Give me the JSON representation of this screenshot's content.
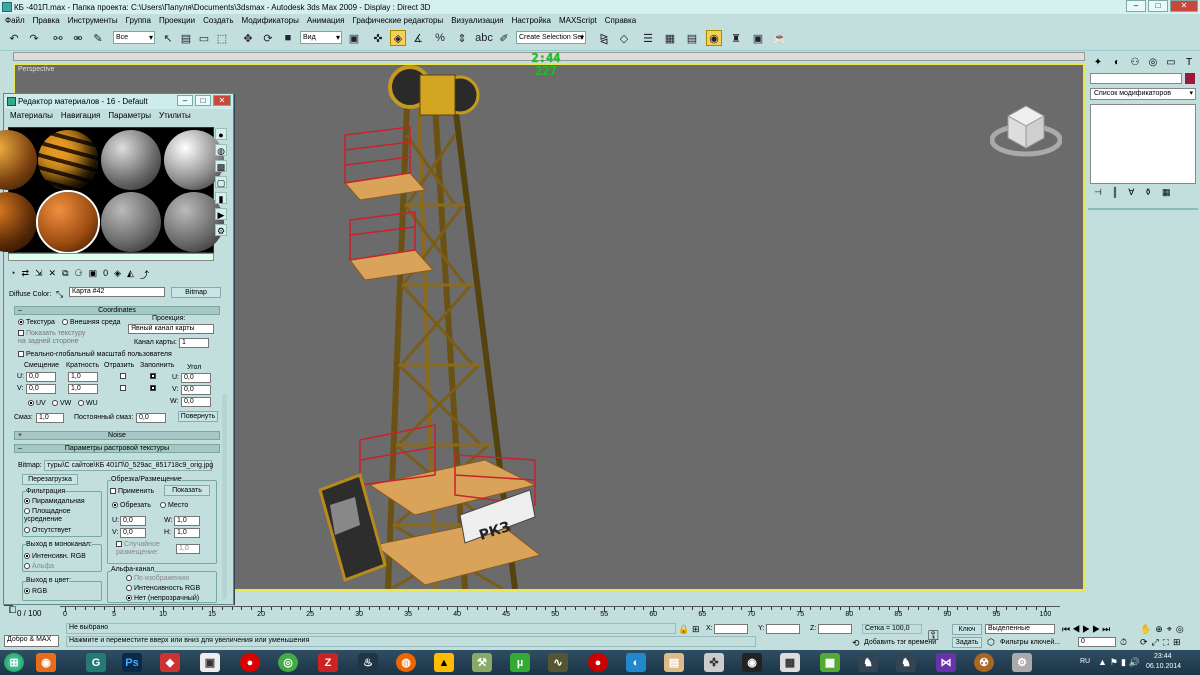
{
  "window": {
    "title": "КБ -401П.max      - Папка проекта: C:\\Users\\Папуля\\Documents\\3dsmax      - Autodesk 3ds Max  2009          - Display : Direct 3D"
  },
  "menu": [
    "Файл",
    "Правка",
    "Инструменты",
    "Группа",
    "Проекции",
    "Создать",
    "Модификаторы",
    "Анимация",
    "Графические редакторы",
    "Визуализация",
    "Настройка",
    "MAXScript",
    "Справка"
  ],
  "toolbar": {
    "filter": "Все",
    "refcoord": "Вид",
    "selection_set": "Create Selection Set"
  },
  "viewport": {
    "label": "Perspective",
    "fps_top": "2:44",
    "fps": "227"
  },
  "right_panel": {
    "modifier_list": "Список модификаторов",
    "object_color": "#9b1a3a"
  },
  "material_editor": {
    "title": "Редактор материалов - 16 - Default",
    "menu": [
      "Материалы",
      "Навигация",
      "Параметры",
      "Утилиты"
    ],
    "diffuse_label": "Diffuse Color:",
    "map_name": "Карта #42",
    "map_type": "Bitmap",
    "coordinates": {
      "header": "Coordinates",
      "texture": "Текстура",
      "environ": "Внешняя среда",
      "mapping_label": "Проекция:",
      "mapping": "Явный канал карты",
      "show_back": "Показать текстуру на задней стороне",
      "map_channel_label": "Канал карты:",
      "map_channel": "1",
      "real_world": "Реально-глобальный масштаб пользователя",
      "offset_label": "Смещение",
      "tiling_label": "Кратность",
      "mirror_label": "Отразить",
      "tile_label": "Заполнить",
      "angle_label": "Угол",
      "u_off": "0,0",
      "v_off": "0,0",
      "u_tile": "1,0",
      "v_tile": "1,0",
      "u_ang": "0,0",
      "v_ang": "0,0",
      "w_ang": "0,0",
      "uv": "UV",
      "vw": "VW",
      "wu": "WU",
      "blur_label": "Смаз:",
      "blur": "1,0",
      "blur_off_label": "Постоянный смаз:",
      "blur_off": "0,0",
      "rotate_btn": "Повернуть"
    },
    "noise_header": "Noise",
    "bitmap_params_header": "Параметры растровой текстуры",
    "bitmap_label": "Bitmap:",
    "bitmap_path": "туры\\С сайтов\\КБ 401П\\0_529ac_851718c9_orig.jpg",
    "reload_btn": "Перезагрузка",
    "filtering": {
      "label": "Фильтрация",
      "pyramidal": "Пирамидальная",
      "summed": "Площадное усреднение",
      "none": "Отсутствует"
    },
    "mono": {
      "label": "Выход в моноканал:",
      "rgb": "Интенсивн. RGB",
      "alpha": "Альфа"
    },
    "rgb_out": {
      "label": "Выход в цвет:",
      "rgb": "RGB"
    },
    "crop": {
      "label": "Обрезка/Размещение",
      "apply": "Применить",
      "view": "Показать",
      "crop": "Обрезать",
      "place": "Место",
      "u": "0,0",
      "v": "0,0",
      "w": "1,0",
      "h": "1,0",
      "jitter": "Случайное размещение:",
      "jitter_val": "1,0"
    },
    "alpha_src": {
      "label": "Альфа-канал",
      "image": "По изображению",
      "rgb": "Интенсивность RGB",
      "none": "Нет (непрозрачный)"
    }
  },
  "timeline": {
    "ticks": [
      "0",
      "5",
      "10",
      "15",
      "20",
      "25",
      "30",
      "35",
      "40",
      "45",
      "50",
      "55",
      "60",
      "65",
      "70",
      "75",
      "80",
      "85",
      "90",
      "95",
      "100"
    ],
    "frame": "0 / 100"
  },
  "status": {
    "selected": "Не выбрано",
    "prompt": "Нажмите и переместите вверх или вниз для увеличения или уменьшения",
    "maxscript": "Добро & MAX",
    "x_label": "X:",
    "y_label": "Y:",
    "z_label": "Z:",
    "grid": "Сетка = 100,0",
    "add_time_tag": "Добавить тэг времени",
    "key_label": "Ключ",
    "set_label": "Задать",
    "key_mode": "Выделенные",
    "key_filters": "Фильтры ключей...",
    "frame_field": "0"
  },
  "taskbar": {
    "lang": "RU",
    "time": "23:44",
    "date": "06.10.2014"
  }
}
